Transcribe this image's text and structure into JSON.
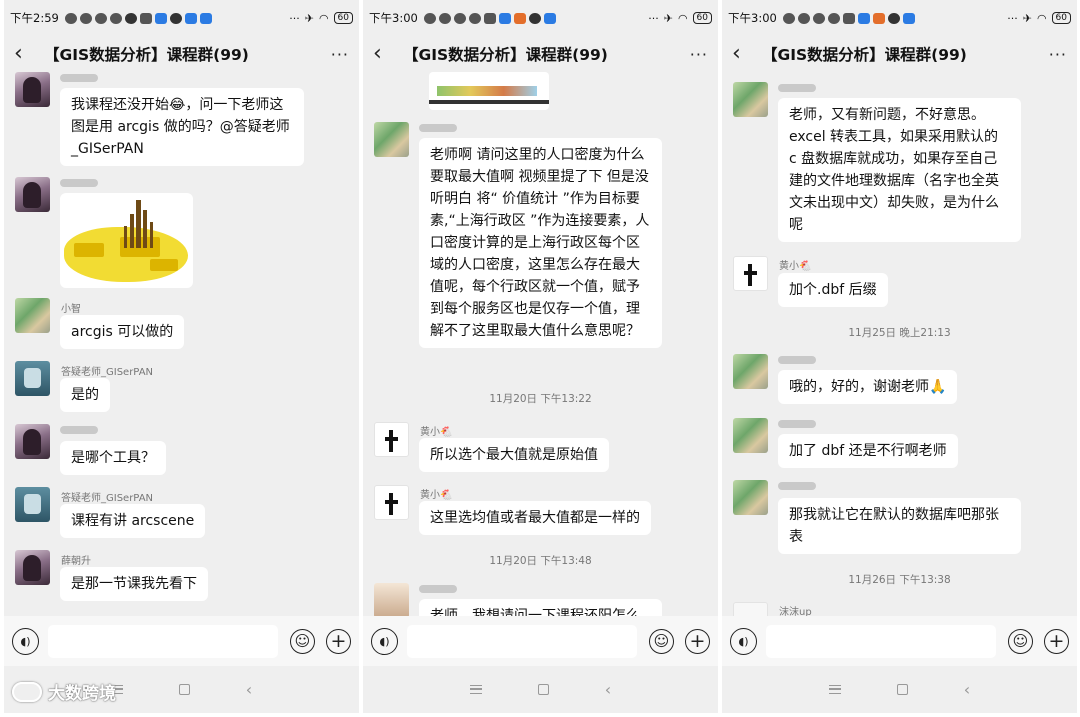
{
  "group_title": "【GIS数据分析】课程群(99)",
  "input_icons": {
    "voice": "voice-icon",
    "emoji": "emoji-icon",
    "plus": "plus-icon"
  },
  "watermark": "大数跨境",
  "screens": [
    {
      "status_time": "下午2:59",
      "battery": "60",
      "messages": [
        {
          "sender": "",
          "text": "我课程还没开始😂，问一下老师这图是用 arcgis 做的吗？@答疑老师_GISerPAN"
        },
        {
          "sender": "",
          "image": "3d-city-map-image"
        },
        {
          "sender": "小智",
          "text": "arcgis 可以做的"
        },
        {
          "sender": "答疑老师_GISerPAN",
          "text": "是的"
        },
        {
          "sender": "",
          "text": "是哪个工具？"
        },
        {
          "sender": "答疑老师_GISerPAN",
          "text": "课程有讲 arcscene"
        },
        {
          "sender": "薛朝升",
          "text": "是那一节课我先看下"
        }
      ]
    },
    {
      "status_time": "下午3:00",
      "battery": "60",
      "messages": [
        {
          "sender": "",
          "image": "map-screenshot-image"
        },
        {
          "sender": "",
          "text": "老师啊  请问这里的人口密度为什么要取最大值啊  视频里提了下 但是没听明白 将“ 价值统计 ”作为目标要素,“上海行政区 ”作为连接要素，人口密度计算的是上海行政区每个区域的人口密度，这里怎么存在最大值呢，每个行政区就一个值，赋予到每个服务区也是仅存一个值，理解不了这里取最大值什么意思呢？"
        },
        {
          "time": "11月20日 下午13:22"
        },
        {
          "sender": "黄小🐔",
          "text": "所以选个最大值就是原始值"
        },
        {
          "sender": "黄小🐔",
          "text": "这里选均值或者最大值都是一样的"
        },
        {
          "time": "11月20日 下午13:48"
        },
        {
          "sender": "",
          "text": "老师，我想请问一下课程还阳怎么"
        }
      ]
    },
    {
      "status_time": "下午3:00",
      "battery": "60",
      "messages": [
        {
          "sender": "",
          "text": "老师，又有新问题，不好意思。excel 转表工具，如果采用默认的 c 盘数据库就成功，如果存至自己建的文件地理数据库（名字也全英文未出现中文）却失败，是为什么呢"
        },
        {
          "sender": "黄小🐔",
          "text": "加个.dbf 后缀"
        },
        {
          "time": "11月25日 晚上21:13"
        },
        {
          "sender": "",
          "text": "哦的，好的，谢谢老师🙏"
        },
        {
          "sender": "",
          "text": "加了 dbf 还是不行啊老师"
        },
        {
          "sender": "",
          "text": "那我就让它在默认的数据库吧那张表"
        },
        {
          "time": "11月26日 下午13:38"
        },
        {
          "sender": "沫沫up"
        }
      ]
    }
  ]
}
